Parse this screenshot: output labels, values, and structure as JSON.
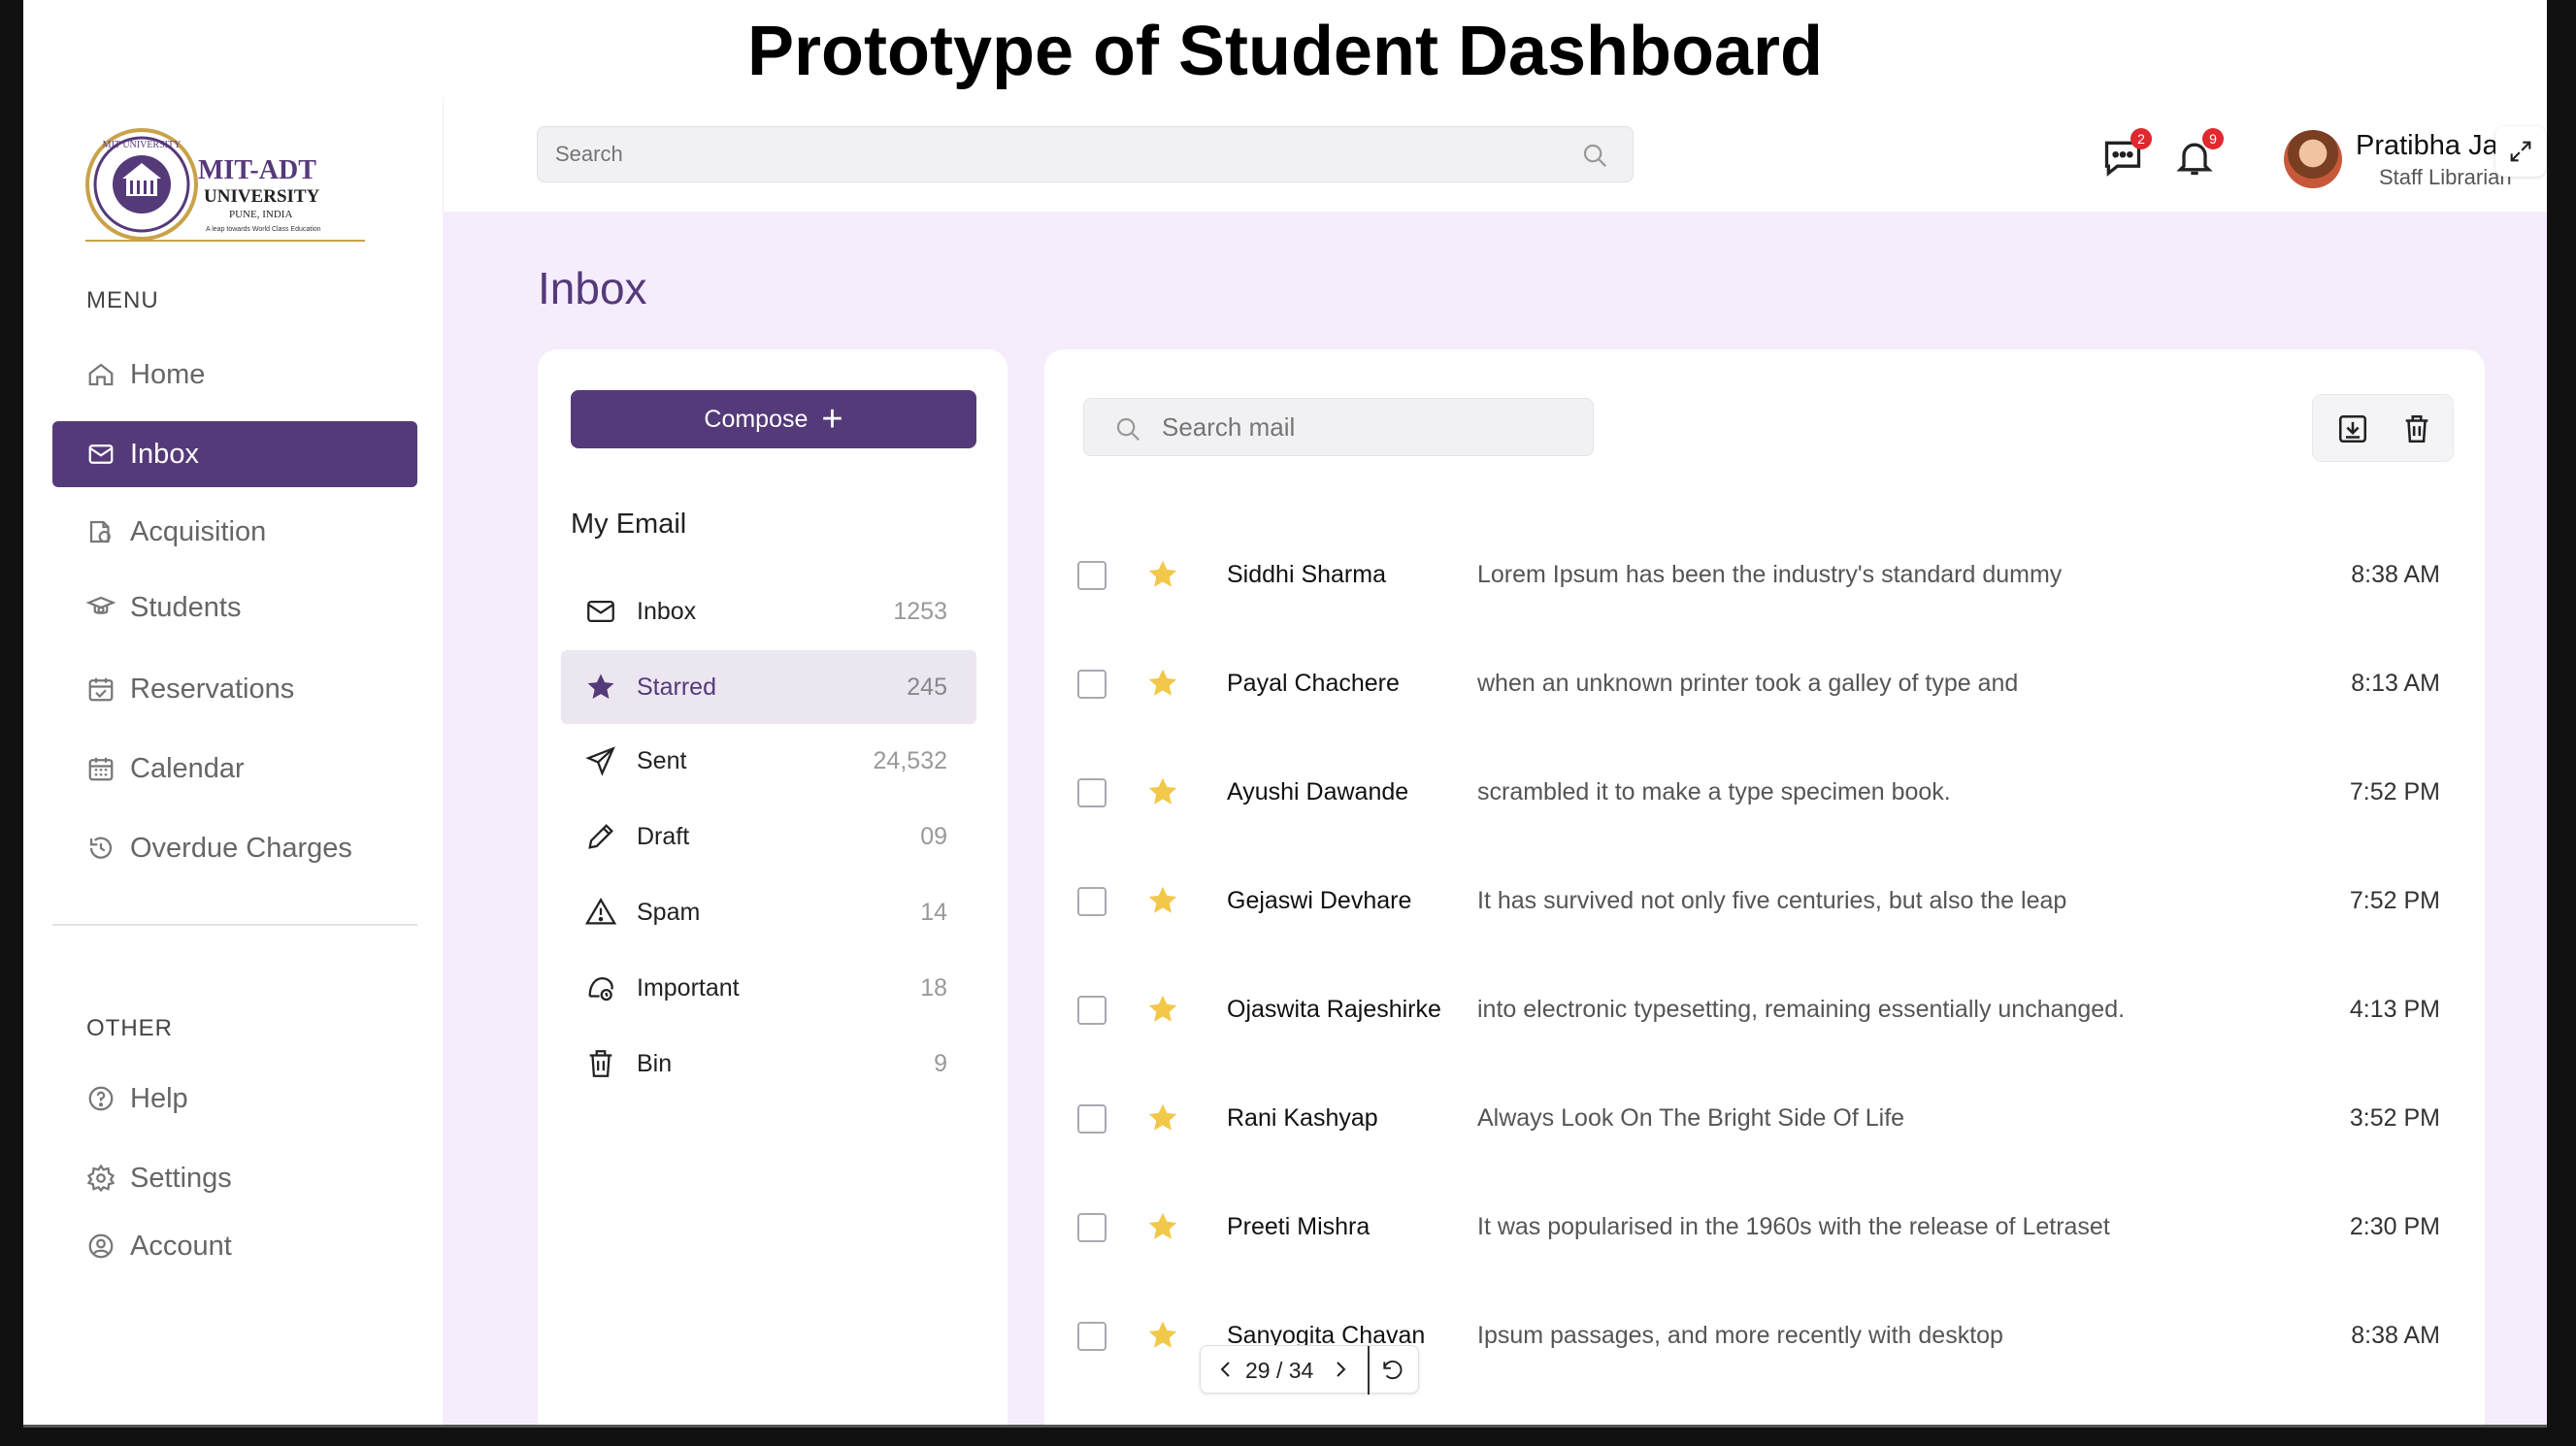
{
  "page_title": "Prototype of Student Dashboard",
  "logo": {
    "name": "MIT-ADT",
    "line2": "UNIVERSITY",
    "line3": "PUNE, INDIA",
    "tagline": "A leap towards World Class Education",
    "seal_text": "MIT UNIVERSITY"
  },
  "sidebar": {
    "menu_label": "MENU",
    "items": [
      {
        "label": "Home",
        "icon": "home-icon"
      },
      {
        "label": "Inbox",
        "icon": "mail-icon"
      },
      {
        "label": "Acquisition",
        "icon": "acquisition-icon"
      },
      {
        "label": "Students",
        "icon": "student-icon"
      },
      {
        "label": "Reservations",
        "icon": "reservation-icon"
      },
      {
        "label": "Calendar",
        "icon": "calendar-icon"
      },
      {
        "label": "Overdue Charges",
        "icon": "history-icon"
      }
    ],
    "other_label": "OTHER",
    "other_items": [
      {
        "label": "Help",
        "icon": "help-icon"
      },
      {
        "label": "Settings",
        "icon": "gear-icon"
      },
      {
        "label": "Account",
        "icon": "account-icon"
      }
    ]
  },
  "header": {
    "search_placeholder": "Search",
    "messages_badge": "2",
    "notifications_badge": "9",
    "user_name": "Pratibha Ja",
    "user_role": "Staff Librarian"
  },
  "inbox": {
    "title": "Inbox",
    "compose_label": "Compose",
    "my_email_label": "My Email",
    "folders": [
      {
        "name": "Inbox",
        "count": "1253",
        "icon": "mail-icon"
      },
      {
        "name": "Starred",
        "count": "245",
        "icon": "star-icon"
      },
      {
        "name": "Sent",
        "count": "24,532",
        "icon": "send-icon"
      },
      {
        "name": "Draft",
        "count": "09",
        "icon": "pencil-icon"
      },
      {
        "name": "Spam",
        "count": "14",
        "icon": "warning-icon"
      },
      {
        "name": "Important",
        "count": "18",
        "icon": "important-icon"
      },
      {
        "name": "Bin",
        "count": "9",
        "icon": "trash-icon"
      }
    ],
    "search_placeholder": "Search mail",
    "messages": [
      {
        "sender": "Siddhi Sharma",
        "subject": "Lorem Ipsum has been the industry's standard dummy",
        "time": "8:38 AM"
      },
      {
        "sender": "Payal Chachere",
        "subject": "when an unknown printer took a galley of type and",
        "time": "8:13 AM"
      },
      {
        "sender": "Ayushi Dawande",
        "subject": " scrambled it to make a type specimen book.",
        "time": "7:52 PM"
      },
      {
        "sender": "Gejaswi Devhare",
        "subject": "It has survived not only five centuries, but also the leap",
        "time": "7:52 PM"
      },
      {
        "sender": "Ojaswita Rajeshirke",
        "subject": "into electronic typesetting, remaining essentially unchanged.",
        "time": "4:13 PM"
      },
      {
        "sender": "Rani Kashyap",
        "subject": "Always Look On The Bright Side Of Life",
        "time": "3:52 PM"
      },
      {
        "sender": "Preeti Mishra",
        "subject": "It was popularised in the 1960s with the release of Letraset",
        "time": "2:30 PM"
      },
      {
        "sender": "Sanyogita Chavan",
        "subject": "Ipsum passages, and more recently with desktop",
        "time": "8:38 AM"
      }
    ]
  },
  "pager": {
    "text": "29 / 34"
  },
  "colors": {
    "accent": "#553a7a",
    "main_bg": "#f5edfb",
    "star": "#f2c84b",
    "badge": "#e0282f"
  }
}
